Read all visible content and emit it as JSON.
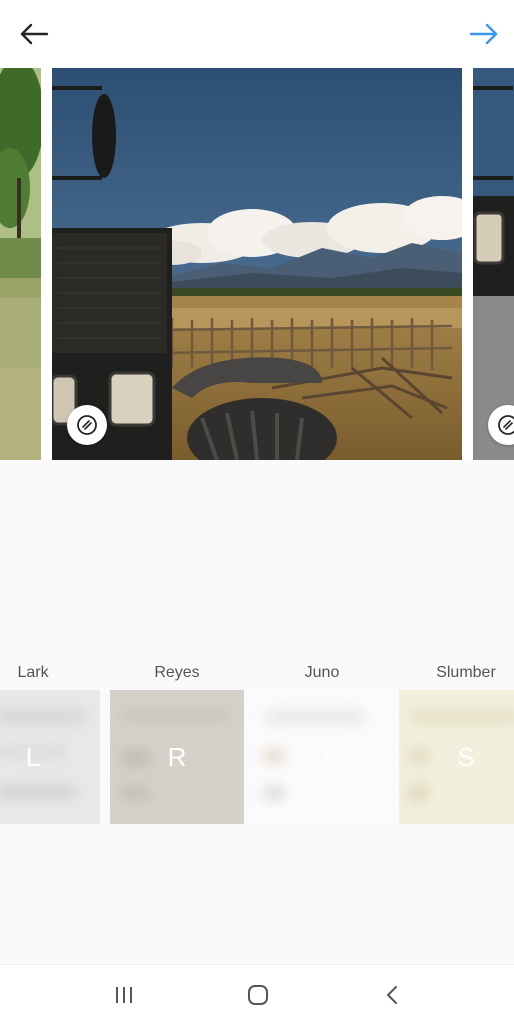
{
  "header": {
    "back_icon": "arrow-left-icon",
    "next_icon": "arrow-right-icon",
    "accent_color": "#3897f0"
  },
  "carousel": {
    "photos": [
      {
        "id": "left-partial",
        "desc_icon": "sticker-icon"
      },
      {
        "id": "main",
        "desc_icon": "sticker-icon"
      },
      {
        "id": "right-partial",
        "desc_icon": "sticker-icon"
      }
    ]
  },
  "filters": [
    {
      "name": "Lark",
      "letter": "L",
      "tint": "#e6e6e6"
    },
    {
      "name": "Reyes",
      "letter": "R",
      "tint": "#d6d1c8"
    },
    {
      "name": "Juno",
      "letter": "J",
      "tint": "#f4f4f4"
    },
    {
      "name": "Slumber",
      "letter": "S",
      "tint": "#efedd8"
    }
  ],
  "navbar": {
    "recent_icon": "recent-apps-icon",
    "home_icon": "home-icon",
    "back_icon": "back-chevron-icon"
  }
}
